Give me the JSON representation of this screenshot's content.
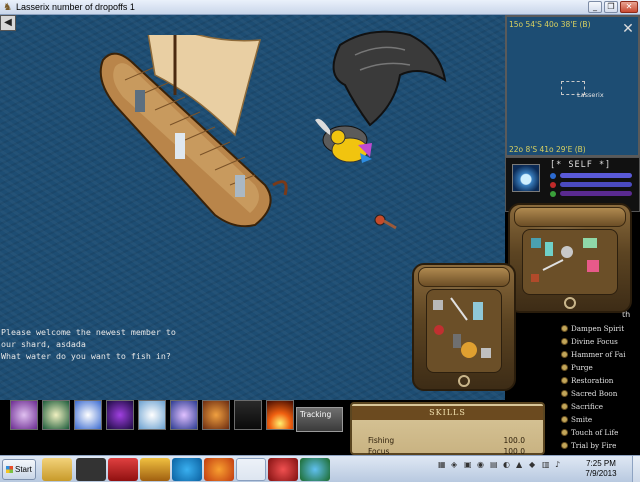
{
  "window": {
    "title": "Lasserix number of dropoffs 1",
    "minimize": "_",
    "maximize": "❐",
    "close": "✕"
  },
  "radar": {
    "top_coord": "15o 54'S 40o 38'E (B)",
    "bottom_coord": "22o 8'S 41o 29'E (B)",
    "player_name": "Lasserix"
  },
  "status": {
    "label": "[* SELF *]",
    "colors": {
      "health": "#5a5ad8",
      "mana": "#4b4bc0",
      "stamina": "#5a2a90"
    }
  },
  "journal": {
    "lines": [
      "Please welcome the newest member to",
      "our shard, asdada",
      "What water do you want to fish in?"
    ]
  },
  "spellbook": {
    "partial_header": "th",
    "spells": [
      "Dampen Spirit",
      "Divine Focus",
      "Hammer of Fai",
      "Purge",
      "Restoration",
      "Sacred Boon",
      "Sacrifice",
      "Smite",
      "Touch of Life",
      "Trial by Fire"
    ]
  },
  "hotbar": {
    "slots": [
      "skill-icon-1",
      "skill-icon-2",
      "skill-icon-3",
      "skill-icon-4",
      "skill-icon-5",
      "skill-icon-6",
      "skill-icon-7",
      "skill-icon-8",
      "skill-icon-9"
    ],
    "tracking_label": "Tracking"
  },
  "skills": {
    "title": "SKILLS",
    "rows": [
      {
        "name": "Fishing",
        "value": "100.0"
      },
      {
        "name": "Focus",
        "value": "100.0"
      }
    ]
  },
  "taskbar": {
    "start_label": "Start",
    "clock_time": "7:25 PM",
    "clock_date": "7/9/2013"
  }
}
